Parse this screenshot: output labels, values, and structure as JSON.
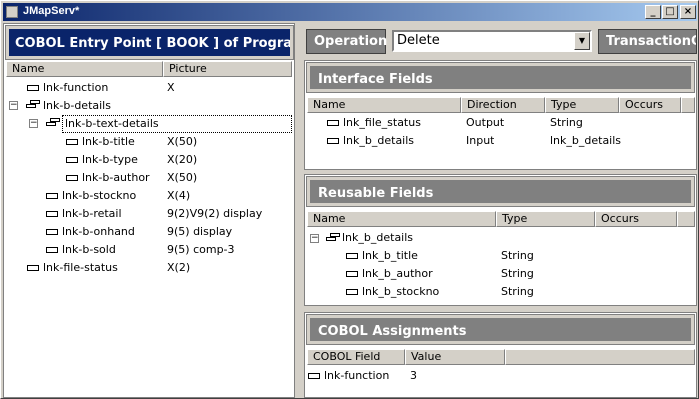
{
  "window": {
    "title": "JMapServ*",
    "min_glyph": "_",
    "max_glyph": "□",
    "close_glyph": "×"
  },
  "left": {
    "header": "COBOL Entry Point [ BOOK ] of Program [ E",
    "columns": [
      "Name",
      "Picture"
    ],
    "rows": [
      {
        "name": "lnk-function",
        "picture": "X"
      },
      {
        "name": "lnk-b-details",
        "picture": ""
      },
      {
        "name": "lnk-b-text-details",
        "picture": ""
      },
      {
        "name": "lnk-b-title",
        "picture": "X(50)"
      },
      {
        "name": "lnk-b-type",
        "picture": "X(20)"
      },
      {
        "name": "lnk-b-author",
        "picture": "X(50)"
      },
      {
        "name": "lnk-b-stockno",
        "picture": "X(4)"
      },
      {
        "name": "lnk-b-retail",
        "picture": "9(2)V9(2) display"
      },
      {
        "name": "lnk-b-onhand",
        "picture": "9(5) display"
      },
      {
        "name": "lnk-b-sold",
        "picture": "9(5) comp-3"
      },
      {
        "name": "lnk-file-status",
        "picture": "X(2)"
      }
    ]
  },
  "operation": {
    "label": "Operation",
    "value": "Delete",
    "dropdown_glyph": "▼",
    "next_label": "TransactionC"
  },
  "interface": {
    "title": "Interface Fields",
    "columns": [
      "Name",
      "Direction",
      "Type",
      "Occurs"
    ],
    "rows": [
      {
        "name": "lnk_file_status",
        "direction": "Output",
        "type": "String"
      },
      {
        "name": "lnk_b_details",
        "direction": "Input",
        "type": "lnk_b_details"
      }
    ]
  },
  "reusable": {
    "title": "Reusable Fields",
    "columns": [
      "Name",
      "Type",
      "Occurs"
    ],
    "rows": [
      {
        "name": "lnk_b_details",
        "type": ""
      },
      {
        "name": "lnk_b_title",
        "type": "String"
      },
      {
        "name": "lnk_b_author",
        "type": "String"
      },
      {
        "name": "lnk_b_stockno",
        "type": "String"
      }
    ]
  },
  "assign": {
    "title": "COBOL Assignments",
    "columns": [
      "COBOL Field",
      "Value"
    ],
    "rows": [
      {
        "field": "lnk-function",
        "value": "3"
      }
    ]
  },
  "tree_glyphs": {
    "collapse": "−"
  }
}
